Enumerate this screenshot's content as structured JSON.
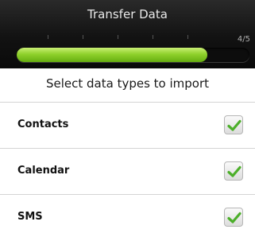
{
  "header": {
    "title": "Transfer Data",
    "step_text": "4/5"
  },
  "progress": {
    "current_step": 4,
    "total_steps": 5,
    "fill_fraction": 0.82
  },
  "sheet": {
    "heading": "Select data types to import",
    "items": [
      {
        "label": "Contacts",
        "checked": true
      },
      {
        "label": "Calendar",
        "checked": true
      },
      {
        "label": "SMS",
        "checked": true
      }
    ]
  },
  "colors": {
    "header_bg": "#121212",
    "progress_green": "#8fd12c",
    "check_green": "#4caf2a"
  }
}
